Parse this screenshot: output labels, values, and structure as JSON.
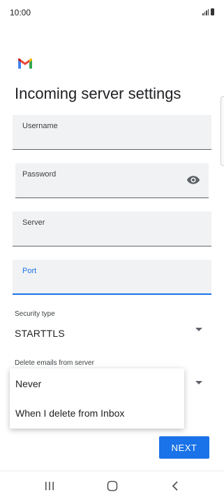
{
  "status_bar": {
    "time": "10:00"
  },
  "header": {
    "title": "Incoming server settings"
  },
  "form": {
    "username": {
      "label": "Username",
      "value": ""
    },
    "password": {
      "label": "Password",
      "value": ""
    },
    "server": {
      "label": "Server",
      "value": ""
    },
    "port": {
      "label": "Port",
      "value": ""
    },
    "security_type": {
      "label": "Security type",
      "value": "STARTTLS"
    },
    "delete_emails": {
      "label": "Delete emails from server"
    }
  },
  "dropdown_menu": {
    "options": [
      "Never",
      "When I delete from Inbox"
    ]
  },
  "actions": {
    "next_label": "NEXT"
  },
  "colors": {
    "accent": "#1a73e8",
    "field_bg": "#f1f2f3"
  },
  "icons": [
    "gmail-logo",
    "eye-icon",
    "dropdown-arrow-icon",
    "recents-icon",
    "home-icon",
    "back-icon"
  ]
}
